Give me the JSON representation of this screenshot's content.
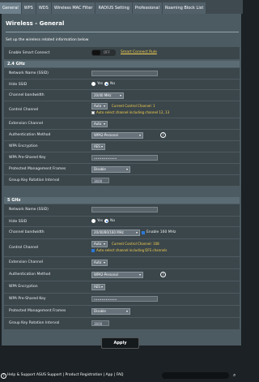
{
  "tabs": [
    "General",
    "WPS",
    "WDS",
    "Wireless MAC Filter",
    "RADIUS Setting",
    "Professional",
    "Roaming Block List"
  ],
  "page": {
    "title": "Wireless - General",
    "description": "Set up the wireless related information below",
    "apply_label": "Apply"
  },
  "smart_connect": {
    "label": "Enable Smart Connect",
    "toggle_text": "OFF",
    "rule_link": "Smart Connect Rule"
  },
  "band_24": {
    "section": "2.4 GHz",
    "ssid_label": "Network Name (SSID)",
    "ssid_value": "",
    "hide_label": "Hide SSID",
    "hide_yes": "Yes",
    "hide_no": "No",
    "bw_label": "Channel bandwidth",
    "bw_value": "20/40 MHz",
    "cc_label": "Control Channel",
    "cc_value": "Auto",
    "cc_current": "Current Control Channel: 1",
    "cc_auto": "Auto select channel including channel 12, 13",
    "ext_label": "Extension Channel",
    "ext_value": "Auto",
    "auth_label": "Authentication Method",
    "auth_value": "WPA2-Personal",
    "enc_label": "WPA Encryption",
    "enc_value": "AES",
    "psk_label": "WPA Pre-Shared Key",
    "psk_value": "••••••••••••",
    "pmf_label": "Protected Management Frames",
    "pmf_value": "Disable",
    "gkr_label": "Group Key Rotation Interval",
    "gkr_value": "3600"
  },
  "band_5": {
    "section": "5 GHz",
    "ssid_label": "Network Name (SSID)",
    "ssid_value": "",
    "hide_label": "Hide SSID",
    "hide_yes": "Yes",
    "hide_no": "No",
    "bw_label": "Channel bandwidth",
    "bw_value": "20/40/80/160 MHz",
    "bw_enable": "Enable 160 MHz",
    "cc_label": "Control Channel",
    "cc_value": "Auto",
    "cc_current": "Current Control Channel: 108",
    "cc_auto": "Auto select channel including DFS channels",
    "ext_label": "Extension Channel",
    "ext_value": "Auto",
    "auth_label": "Authentication Method",
    "auth_value": "WPA2-Personal",
    "enc_label": "WPA Encryption",
    "enc_value": "AES",
    "psk_label": "WPA Pre-Shared Key",
    "psk_value": "••••••••••••",
    "pmf_label": "Protected Management Frames",
    "pmf_value": "Disable",
    "gkr_label": "Group Key Rotation Interval",
    "gkr_value": "3600"
  },
  "footer": {
    "text": "Help & Support  ASUS Support | Product Registration | App | FAQ"
  }
}
